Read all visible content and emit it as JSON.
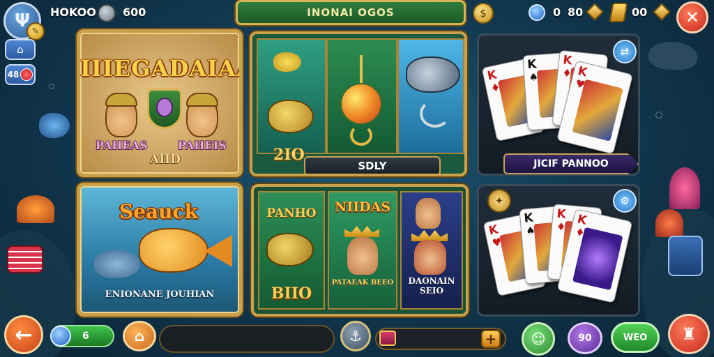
{
  "top_bar": {
    "avatar_icon": "trident-icon",
    "coins_label": "HOKOO",
    "coins_value": "600",
    "title": "INONAI OGOS",
    "gem_value": "0",
    "gem_value2": "80",
    "tag_value": "00"
  },
  "side_buttons": [
    {
      "icon": "house-icon"
    },
    {
      "label": "48"
    }
  ],
  "game_tiles": {
    "tile1": {
      "title": "IIIEGADAIAA",
      "left_label": "PAHEAS",
      "mid_label": "AIID",
      "right_label": "PAHEIS"
    },
    "tile2": {
      "title": "Seauck",
      "subtitle": "ENIONANE JOUHIAN"
    },
    "tile3": {
      "number": "2IO",
      "bar_label": "SDLY"
    },
    "tile4": {
      "col1_title": "PANHO",
      "col1_bottom": "BIIO",
      "col2_title": "NIIDAS",
      "col2_bottom": "PATAEAK BEEO",
      "col3_bottom": "DAONAIN SEIO"
    }
  },
  "card_panels": {
    "panel1": {
      "label": "JICIF PANNOO",
      "cards": [
        {
          "rank": "K",
          "suit": "♦",
          "color": "red"
        },
        {
          "rank": "K",
          "suit": "♠",
          "color": "black"
        },
        {
          "rank": "K",
          "suit": "♦",
          "color": "red"
        },
        {
          "rank": "K",
          "suit": "♥",
          "color": "red"
        }
      ]
    },
    "panel2": {
      "cards": [
        {
          "rank": "K",
          "suit": "♥",
          "color": "red"
        },
        {
          "rank": "K",
          "suit": "♠",
          "color": "black"
        },
        {
          "rank": "K",
          "suit": "♦",
          "color": "red"
        },
        {
          "rank": "K",
          "suit": "♦",
          "color": "red"
        }
      ]
    }
  },
  "bottom_bar": {
    "gem_count": "6",
    "purple_label": "90",
    "green_label": "WEO"
  }
}
